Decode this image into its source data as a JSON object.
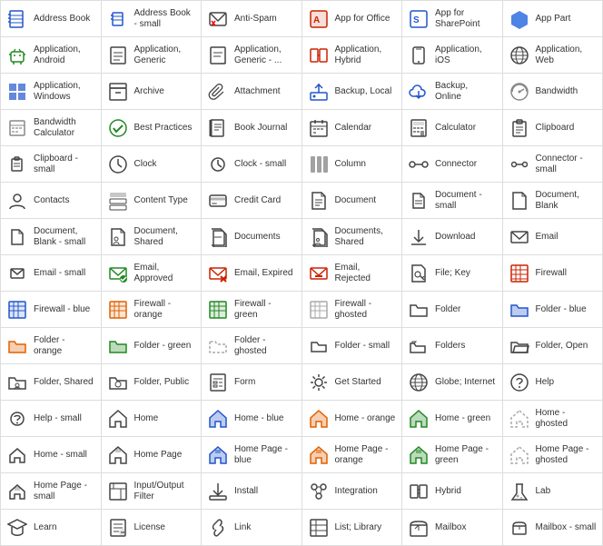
{
  "items": [
    {
      "label": "Address Book",
      "icon": "address-book",
      "color": "#2255cc"
    },
    {
      "label": "Address Book - small",
      "icon": "address-book-small",
      "color": "#2255cc"
    },
    {
      "label": "Anti-Spam",
      "icon": "anti-spam",
      "color": "#444"
    },
    {
      "label": "App for Office",
      "icon": "app-office",
      "color": "#cc2200"
    },
    {
      "label": "App for SharePoint",
      "icon": "app-sharepoint",
      "color": "#2255cc"
    },
    {
      "label": "App Part",
      "icon": "app-part",
      "color": "#2266dd"
    },
    {
      "label": "Application, Android",
      "icon": "app-android",
      "color": "#228822"
    },
    {
      "label": "Application, Generic",
      "icon": "app-generic",
      "color": "#444"
    },
    {
      "label": "Application, Generic - ...",
      "icon": "app-generic2",
      "color": "#444"
    },
    {
      "label": "Application, Hybrid",
      "icon": "app-hybrid",
      "color": "#cc2200"
    },
    {
      "label": "Application, iOS",
      "icon": "app-ios",
      "color": "#444"
    },
    {
      "label": "Application, Web",
      "icon": "app-web",
      "color": "#444"
    },
    {
      "label": "Application, Windows",
      "icon": "app-windows",
      "color": "#2255cc"
    },
    {
      "label": "Archive",
      "icon": "archive",
      "color": "#444"
    },
    {
      "label": "Attachment",
      "icon": "attachment",
      "color": "#444"
    },
    {
      "label": "Backup, Local",
      "icon": "backup-local",
      "color": "#2255cc"
    },
    {
      "label": "Backup, Online",
      "icon": "backup-online",
      "color": "#2255cc"
    },
    {
      "label": "Bandwidth",
      "icon": "bandwidth",
      "color": "#888"
    },
    {
      "label": "Bandwidth Calculator",
      "icon": "bandwidth-calc",
      "color": "#888"
    },
    {
      "label": "Best Practices",
      "icon": "best-practices",
      "color": "#228822"
    },
    {
      "label": "Book Journal",
      "icon": "book-journal",
      "color": "#444"
    },
    {
      "label": "Calendar",
      "icon": "calendar",
      "color": "#444"
    },
    {
      "label": "Calculator",
      "icon": "calculator",
      "color": "#444"
    },
    {
      "label": "Clipboard",
      "icon": "clipboard",
      "color": "#444"
    },
    {
      "label": "Clipboard - small",
      "icon": "clipboard-small",
      "color": "#444"
    },
    {
      "label": "Clock",
      "icon": "clock",
      "color": "#444"
    },
    {
      "label": "Clock - small",
      "icon": "clock-small",
      "color": "#444"
    },
    {
      "label": "Column",
      "icon": "column",
      "color": "#444"
    },
    {
      "label": "Connector",
      "icon": "connector",
      "color": "#444"
    },
    {
      "label": "Connector - small",
      "icon": "connector-small",
      "color": "#444"
    },
    {
      "label": "Contacts",
      "icon": "contacts",
      "color": "#444"
    },
    {
      "label": "Content Type",
      "icon": "content-type",
      "color": "#444"
    },
    {
      "label": "Credit Card",
      "icon": "credit-card",
      "color": "#444"
    },
    {
      "label": "Document",
      "icon": "document",
      "color": "#444"
    },
    {
      "label": "Document - small",
      "icon": "document-small",
      "color": "#444"
    },
    {
      "label": "Document, Blank",
      "icon": "document-blank",
      "color": "#444"
    },
    {
      "label": "Document, Blank - small",
      "icon": "doc-blank-small",
      "color": "#444"
    },
    {
      "label": "Document, Shared",
      "icon": "doc-shared",
      "color": "#444"
    },
    {
      "label": "Documents",
      "icon": "documents",
      "color": "#444"
    },
    {
      "label": "Documents, Shared",
      "icon": "docs-shared",
      "color": "#444"
    },
    {
      "label": "Download",
      "icon": "download",
      "color": "#444"
    },
    {
      "label": "Email",
      "icon": "email",
      "color": "#444"
    },
    {
      "label": "Email - small",
      "icon": "email-small",
      "color": "#444"
    },
    {
      "label": "Email, Approved",
      "icon": "email-approved",
      "color": "#228822"
    },
    {
      "label": "Email, Expired",
      "icon": "email-expired",
      "color": "#cc2200"
    },
    {
      "label": "Email, Rejected",
      "icon": "email-rejected",
      "color": "#cc2200"
    },
    {
      "label": "File; Key",
      "icon": "file-key",
      "color": "#444"
    },
    {
      "label": "Firewall",
      "icon": "firewall",
      "color": "#cc2200"
    },
    {
      "label": "Firewall - blue",
      "icon": "firewall-blue",
      "color": "#2255cc"
    },
    {
      "label": "Firewall - orange",
      "icon": "firewall-orange",
      "color": "#e06000"
    },
    {
      "label": "Firewall - green",
      "icon": "firewall-green",
      "color": "#228822"
    },
    {
      "label": "Firewall - ghosted",
      "icon": "firewall-ghosted",
      "color": "#aaa"
    },
    {
      "label": "Folder",
      "icon": "folder",
      "color": "#444"
    },
    {
      "label": "Folder - blue",
      "icon": "folder-blue",
      "color": "#2255cc"
    },
    {
      "label": "Folder - orange",
      "icon": "folder-orange",
      "color": "#e06000"
    },
    {
      "label": "Folder - green",
      "icon": "folder-green",
      "color": "#228822"
    },
    {
      "label": "Folder - ghosted",
      "icon": "folder-ghosted",
      "color": "#aaa"
    },
    {
      "label": "Folder - small",
      "icon": "folder-small",
      "color": "#444"
    },
    {
      "label": "Folders",
      "icon": "folders",
      "color": "#444"
    },
    {
      "label": "Folder, Open",
      "icon": "folder-open",
      "color": "#444"
    },
    {
      "label": "Folder, Shared",
      "icon": "folder-shared",
      "color": "#444"
    },
    {
      "label": "Folder, Public",
      "icon": "folder-public",
      "color": "#444"
    },
    {
      "label": "Form",
      "icon": "form",
      "color": "#444"
    },
    {
      "label": "Get Started",
      "icon": "get-started",
      "color": "#444"
    },
    {
      "label": "Globe; Internet",
      "icon": "globe",
      "color": "#444"
    },
    {
      "label": "Help",
      "icon": "help",
      "color": "#444"
    },
    {
      "label": "Help - small",
      "icon": "help-small",
      "color": "#444"
    },
    {
      "label": "Home",
      "icon": "home",
      "color": "#444"
    },
    {
      "label": "Home - blue",
      "icon": "home-blue",
      "color": "#2255cc"
    },
    {
      "label": "Home - orange",
      "icon": "home-orange",
      "color": "#e06000"
    },
    {
      "label": "Home - green",
      "icon": "home-green",
      "color": "#228822"
    },
    {
      "label": "Home - ghosted",
      "icon": "home-ghosted",
      "color": "#aaa"
    },
    {
      "label": "Home - small",
      "icon": "home-small",
      "color": "#444"
    },
    {
      "label": "Home Page",
      "icon": "home-page",
      "color": "#444"
    },
    {
      "label": "Home Page - blue",
      "icon": "home-page-blue",
      "color": "#2255cc"
    },
    {
      "label": "Home Page - orange",
      "icon": "home-page-orange",
      "color": "#e06000"
    },
    {
      "label": "Home Page - green",
      "icon": "home-page-green",
      "color": "#228822"
    },
    {
      "label": "Home Page - ghosted",
      "icon": "home-page-ghosted",
      "color": "#aaa"
    },
    {
      "label": "Home Page - small",
      "icon": "home-page-small",
      "color": "#444"
    },
    {
      "label": "Input/Output Filter",
      "icon": "io-filter",
      "color": "#444"
    },
    {
      "label": "Install",
      "icon": "install",
      "color": "#444"
    },
    {
      "label": "Integration",
      "icon": "integration",
      "color": "#444"
    },
    {
      "label": "Hybrid",
      "icon": "hybrid",
      "color": "#444"
    },
    {
      "label": "Lab",
      "icon": "lab",
      "color": "#444"
    },
    {
      "label": "Learn",
      "icon": "learn",
      "color": "#444"
    },
    {
      "label": "License",
      "icon": "license",
      "color": "#444"
    },
    {
      "label": "Link",
      "icon": "link",
      "color": "#444"
    },
    {
      "label": "List; Library",
      "icon": "list-library",
      "color": "#444"
    },
    {
      "label": "Mailbox",
      "icon": "mailbox",
      "color": "#444"
    },
    {
      "label": "Mailbox - small",
      "icon": "mailbox-small",
      "color": "#444"
    }
  ]
}
